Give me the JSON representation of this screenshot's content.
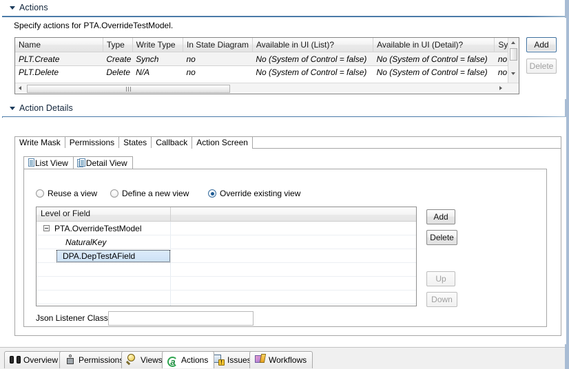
{
  "window": {
    "accent_color": "#4a7aa8",
    "rail_color": "#a8bcd4"
  },
  "actions_section": {
    "title": "Actions",
    "twisty": "triangle-down-icon",
    "instruction": "Specify actions for PTA.OverrideTestModel.",
    "grid": {
      "columns": [
        "Name",
        "Type",
        "Write Type",
        "In State Diagram",
        "Available in UI (List)?",
        "Available in UI (Detail)?",
        "Sys of"
      ],
      "rows": [
        {
          "name": "PLT.Create",
          "type": "Create",
          "write_type": "Synch",
          "in_state_diagram": "no",
          "available_list": "No (System of Control = false)",
          "available_detail": "No (System of Control = false)",
          "sys_of": "no",
          "selected": true
        },
        {
          "name": "PLT.Delete",
          "type": "Delete",
          "write_type": "N/A",
          "in_state_diagram": "no",
          "available_list": "No (System of Control = false)",
          "available_detail": "No (System of Control = false)",
          "sys_of": "no",
          "selected": false
        }
      ]
    },
    "buttons": {
      "add": "Add",
      "delete": "Delete",
      "delete_disabled": true
    }
  },
  "details_section": {
    "title": "Action Details",
    "twisty": "triangle-down-icon",
    "tabs": [
      {
        "label": "Write Mask",
        "active": false
      },
      {
        "label": "Permissions",
        "active": false
      },
      {
        "label": "States",
        "active": false
      },
      {
        "label": "Callback",
        "active": false
      },
      {
        "label": "Action Screen",
        "active": true
      }
    ],
    "view_tabs": [
      {
        "label": "List View",
        "icon": "document-icon",
        "active": false
      },
      {
        "label": "Detail View",
        "icon": "documents-icon",
        "active": true
      }
    ],
    "radios": [
      {
        "label": "Reuse a view",
        "selected": false
      },
      {
        "label": "Define a new view",
        "selected": false
      },
      {
        "label": "Override existing view",
        "selected": true
      }
    ],
    "tree": {
      "column_header": "Level or Field",
      "nodes": [
        {
          "label": "PTA.OverrideTestModel",
          "level": 0,
          "expander": "minus",
          "italic": false,
          "selected": false
        },
        {
          "label": "NaturalKey",
          "level": 1,
          "expander": "none",
          "italic": true,
          "selected": false
        },
        {
          "label": "DPA.DepTestAField",
          "level": 1,
          "expander": "none",
          "italic": false,
          "selected": true
        }
      ]
    },
    "tree_buttons": {
      "add": "Add",
      "delete": "Delete",
      "up": "Up",
      "down": "Down",
      "up_disabled": true,
      "down_disabled": true
    },
    "json_listener": {
      "label": "Json Listener Class:",
      "value": "",
      "placeholder": ""
    }
  },
  "bottom_tabs": [
    {
      "label": "Overview",
      "icon": "binoculars-icon",
      "active": false
    },
    {
      "label": "Permissions",
      "icon": "person-icon",
      "active": false
    },
    {
      "label": "Views",
      "icon": "magnifier-icon",
      "active": false
    },
    {
      "label": "Actions",
      "icon": "action-circle-icon",
      "active": true
    },
    {
      "label": "Issues",
      "icon": "issues-icon",
      "active": false
    },
    {
      "label": "Workflows",
      "icon": "workflows-icon",
      "active": false
    }
  ]
}
